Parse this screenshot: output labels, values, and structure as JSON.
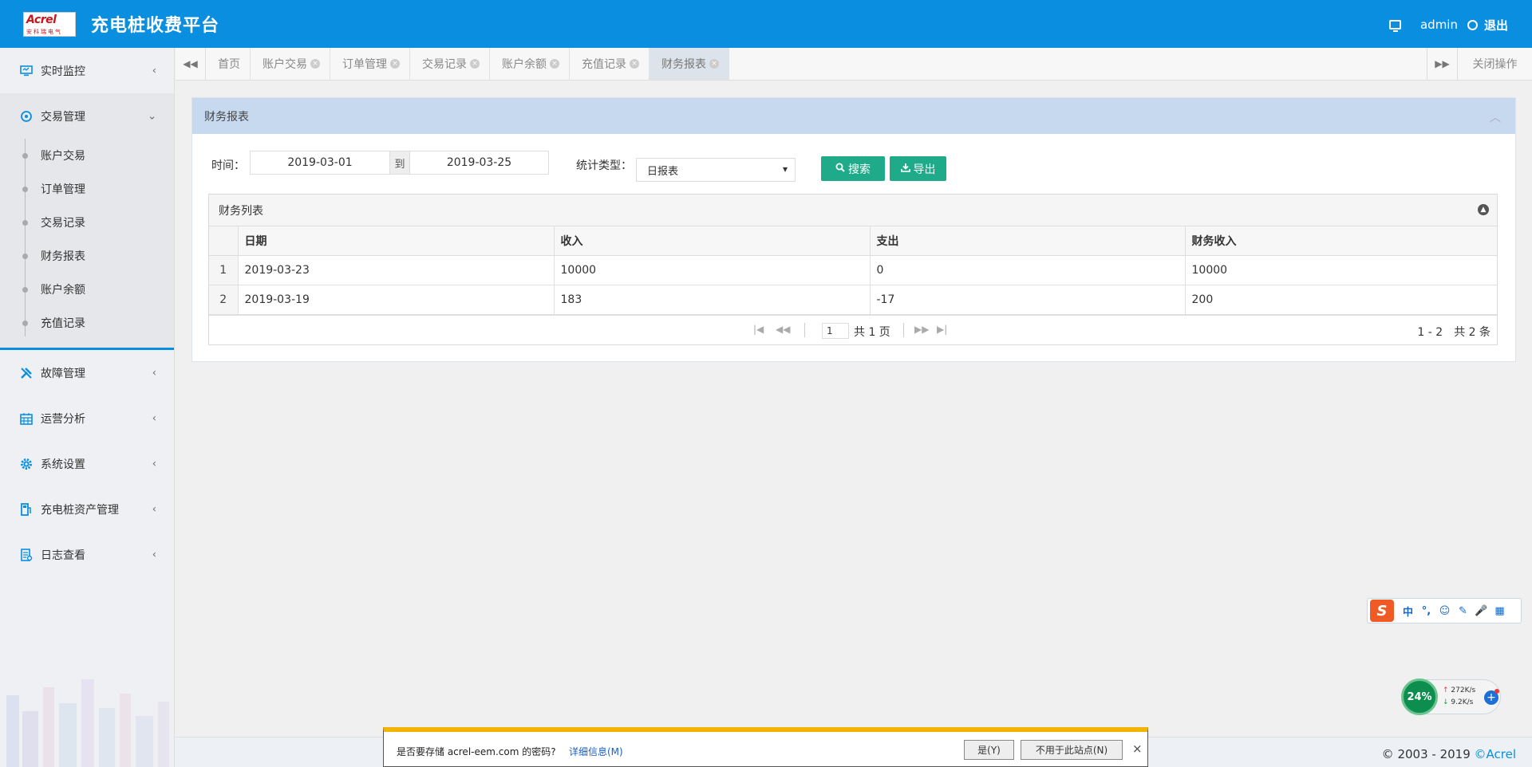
{
  "header": {
    "logo_brand": "Acrel",
    "logo_sub": "安科瑞电气",
    "app_title": "充电桩收费平台",
    "user": "admin",
    "logout": "退出"
  },
  "sidebar": {
    "items": [
      {
        "label": "实时监控",
        "icon": "monitor-icon"
      },
      {
        "label": "交易管理",
        "icon": "refresh-icon",
        "expanded": true
      },
      {
        "label": "故障管理",
        "icon": "wrench-icon"
      },
      {
        "label": "运营分析",
        "icon": "calendar-icon"
      },
      {
        "label": "系统设置",
        "icon": "gear-icon"
      },
      {
        "label": "充电桩资产管理",
        "icon": "charger-icon"
      },
      {
        "label": "日志查看",
        "icon": "log-icon"
      }
    ],
    "subitems": [
      "账户交易",
      "订单管理",
      "交易记录",
      "财务报表",
      "账户余额",
      "充值记录"
    ]
  },
  "tabs": {
    "items": [
      "首页",
      "账户交易",
      "订单管理",
      "交易记录",
      "账户余额",
      "充值记录",
      "财务报表"
    ],
    "active": "财务报表",
    "close_ops": "关闭操作"
  },
  "panel": {
    "title": "财务报表",
    "time_label": "时间：",
    "date_from": "2019-03-01",
    "date_sep": "到",
    "date_to": "2019-03-25",
    "type_label": "统计类型：",
    "type_value": "日报表",
    "search_btn": "搜索",
    "export_btn": "导出"
  },
  "grid": {
    "caption": "财务列表",
    "columns": [
      "日期",
      "收入",
      "支出",
      "财务收入"
    ],
    "rows": [
      {
        "n": "1",
        "date": "2019-03-23",
        "income": "10000",
        "expense": "0",
        "finance": "10000"
      },
      {
        "n": "2",
        "date": "2019-03-19",
        "income": "183",
        "expense": "-17",
        "finance": "200"
      }
    ],
    "page_value": "1",
    "page_total": "共 1 页",
    "range": "1 - 2　共 2 条"
  },
  "footer": {
    "copyright": "© 2003 - 2019 ",
    "brand": "©Acrel"
  },
  "password_bar": {
    "question": "是否要存储 acrel-eem.com 的密码?",
    "more": "详细信息(M)",
    "yes": "是(Y)",
    "no": "不用于此站点(N)",
    "close": "×"
  },
  "ime": {
    "logo": "S",
    "lang": "中",
    "punct": "°,",
    "emoji": "☺",
    "pen": "✎",
    "mic": "🎤",
    "grid": "▦"
  },
  "netmon": {
    "percent": "24%",
    "up": "272K/s",
    "down": "9.2K/s"
  },
  "colors": {
    "header": "#0a8fe0",
    "panel_head": "#c6d9ee",
    "button": "#1fab89"
  }
}
